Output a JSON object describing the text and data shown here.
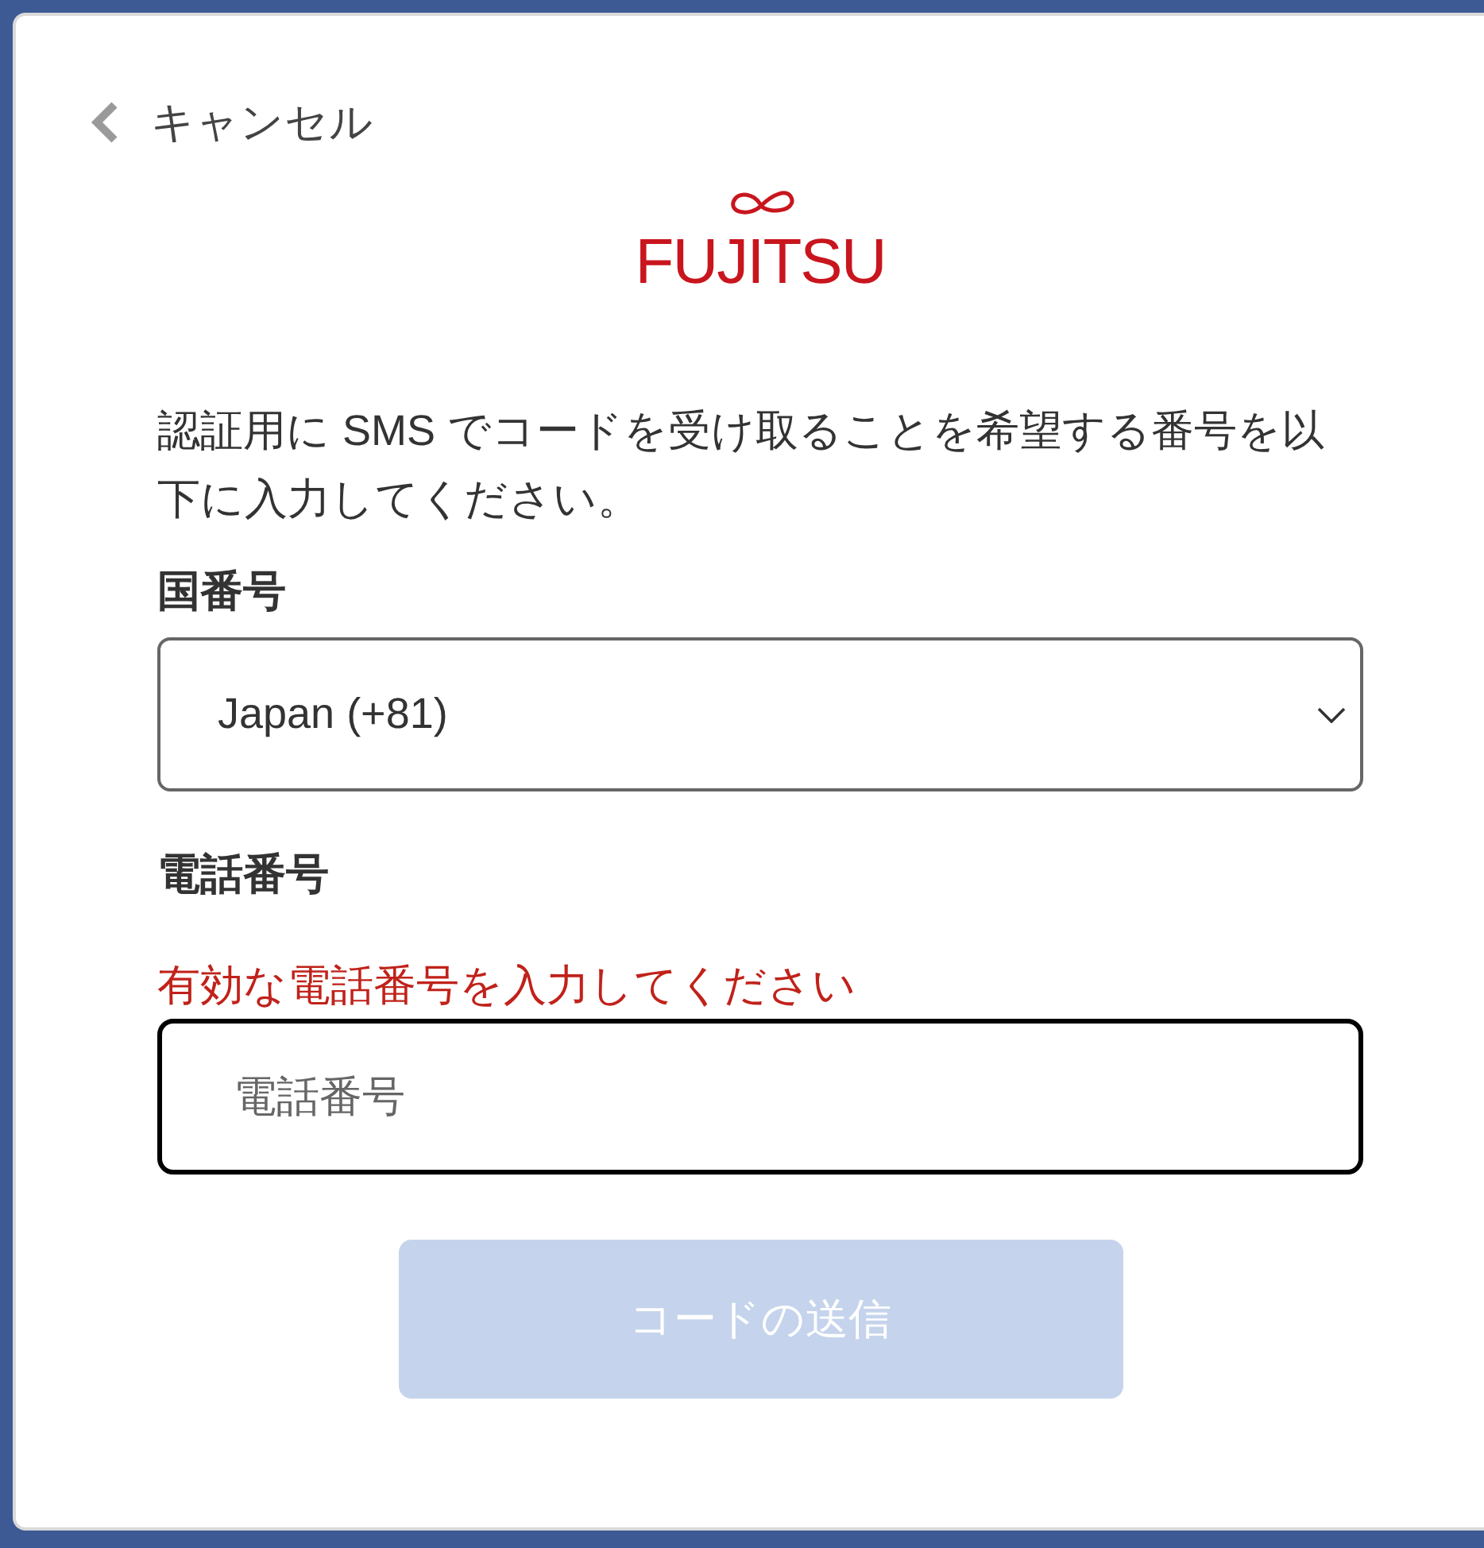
{
  "cancel_link": {
    "label": "キャンセル"
  },
  "logo": {
    "text": "FUJITSU"
  },
  "instructions": "認証用に SMS でコードを受け取ることを希望する番号を以下に入力してください。",
  "country_code": {
    "label": "国番号",
    "value": "Japan (+81)"
  },
  "phone_number": {
    "label": "電話番号",
    "error": "有効な電話番号を入力してください",
    "placeholder": "電話番号",
    "focused": true
  },
  "send_button": {
    "label": "コードの送信",
    "disabled": true
  }
}
